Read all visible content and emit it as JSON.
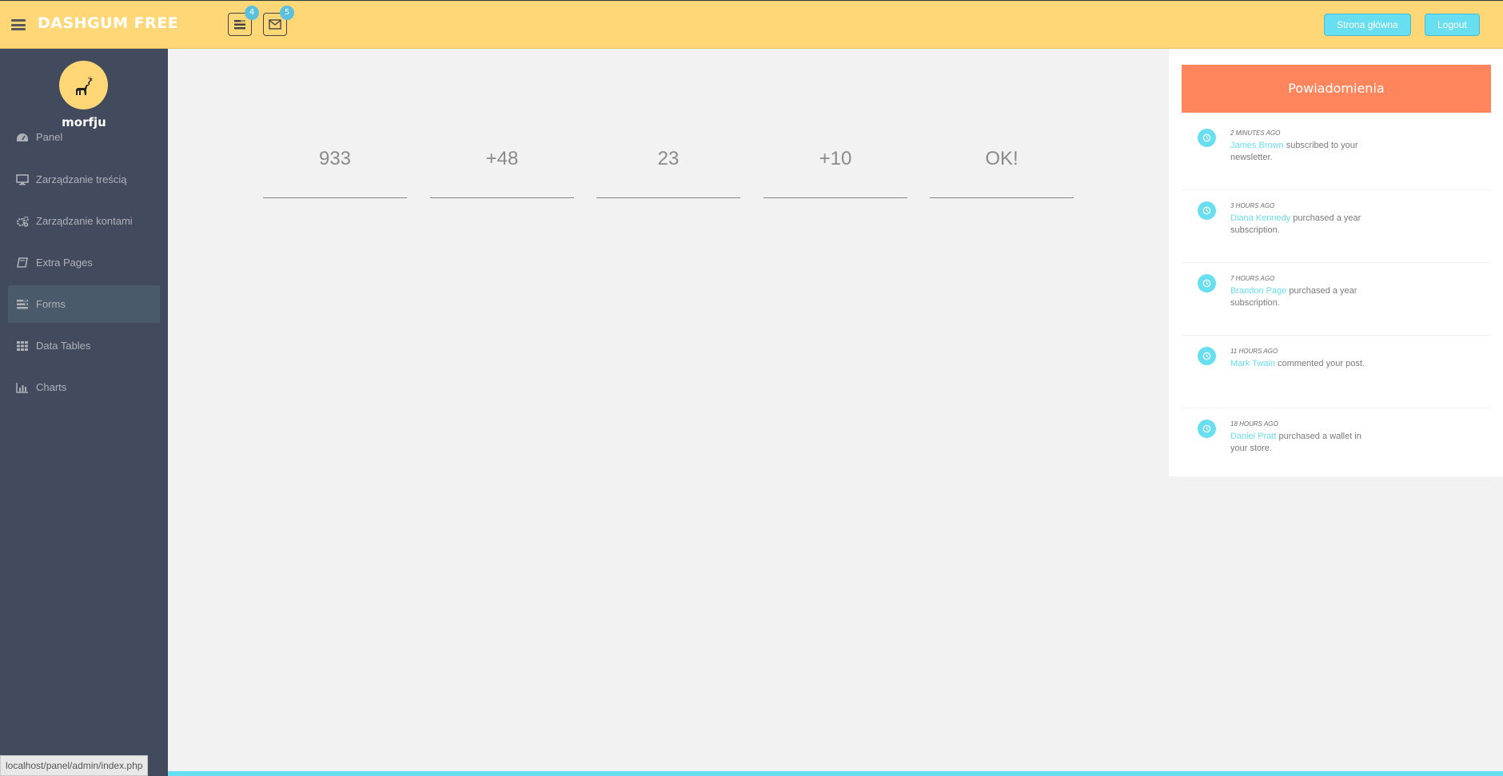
{
  "header": {
    "logo": "DASHGUM FREE",
    "tasks_badge": "4",
    "messages_badge": "5",
    "home_button": "Strona główna",
    "logout_button": "Logout"
  },
  "sidebar": {
    "username": "morfju",
    "items": [
      {
        "label": "Panel",
        "icon": "dashboard-icon"
      },
      {
        "label": "Zarządzanie treścią",
        "icon": "desktop-icon"
      },
      {
        "label": "Zarządzanie kontami",
        "icon": "cogs-icon"
      },
      {
        "label": "Extra Pages",
        "icon": "book-icon"
      },
      {
        "label": "Forms",
        "icon": "tasks-icon"
      },
      {
        "label": "Data Tables",
        "icon": "th-icon"
      },
      {
        "label": "Charts",
        "icon": "bar-chart-icon"
      }
    ],
    "active_index": 4
  },
  "status_url": "localhost/panel/admin/index.php",
  "stats": [
    "933",
    "+48",
    "23",
    "+10",
    "OK!"
  ],
  "notifications": {
    "title": "Powiadomienia",
    "items": [
      {
        "time": "2 Minutes Ago",
        "who": "James Brown",
        "text": " subscribed to your newsletter."
      },
      {
        "time": "3 Hours Ago",
        "who": "Diana Kennedy",
        "text": " purchased a year subscription."
      },
      {
        "time": "7 Hours Ago",
        "who": "Brandon Page",
        "text": " purchased a year subscription."
      },
      {
        "time": "11 Hours Ago",
        "who": "Mark Twain",
        "text": " commented your post."
      },
      {
        "time": "18 Hours Ago",
        "who": "Daniel Pratt",
        "text": " purchased a wallet in your store."
      }
    ]
  },
  "colors": {
    "header": "#ffd777",
    "sidebar": "#424a5d",
    "accent": "#68dff0",
    "panel_head": "#ff865c"
  }
}
